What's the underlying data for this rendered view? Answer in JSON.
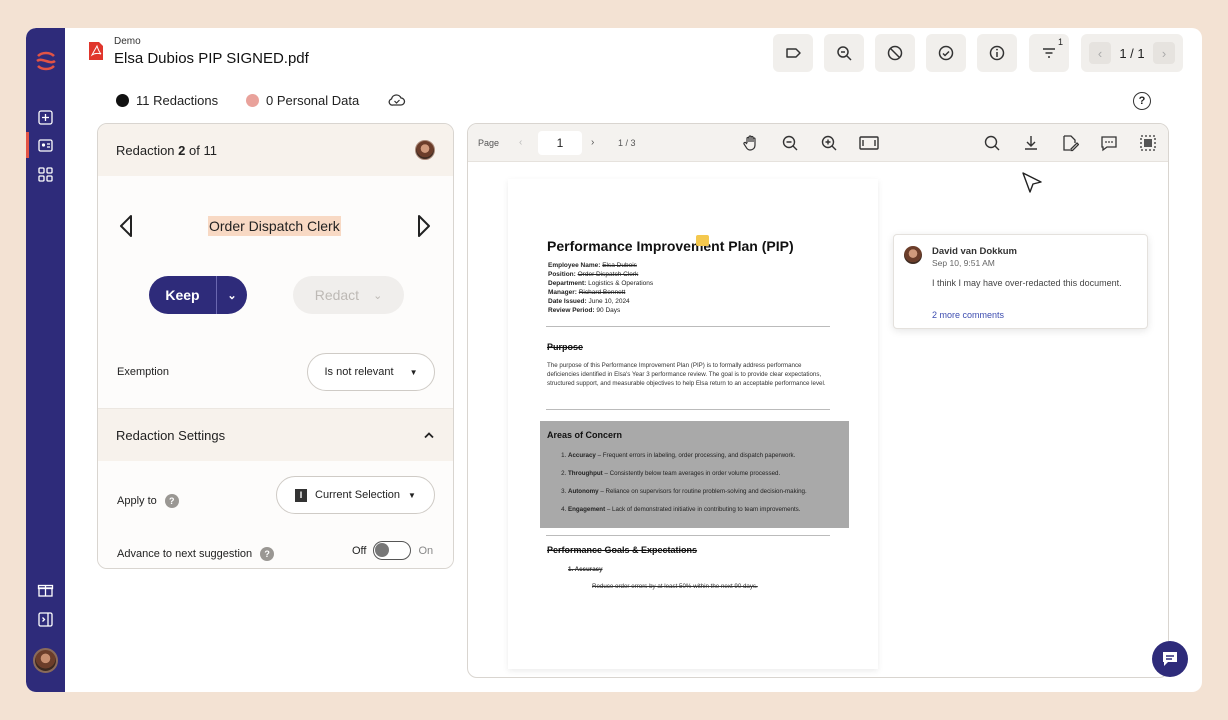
{
  "header": {
    "workspace": "Demo",
    "filename": "Elsa Dubios PIP SIGNED.pdf",
    "filter_badge": "1",
    "pager": "1 / 1"
  },
  "toolbar": {
    "icons": [
      "tag-icon",
      "zoom-search-icon",
      "block-icon",
      "check-circle-icon",
      "info-icon",
      "filter-icon"
    ]
  },
  "stats": {
    "redactions": "11 Redactions",
    "personal_data": "0 Personal Data"
  },
  "colors": {
    "brand": "#2e2b7a",
    "accent_red": "#e25345",
    "highlight": "#f8d9c4",
    "personal_dot": "#e9a29b"
  },
  "panel": {
    "redaction_prefix": "Redaction ",
    "redaction_num": "2",
    "redaction_suffix": " of 11",
    "selected_text": "Order Dispatch Clerk",
    "keep_label": "Keep",
    "redact_label": "Redact",
    "exemption_label": "Exemption",
    "exemption_value": "Is not relevant",
    "settings_title": "Redaction Settings",
    "apply_to_label": "Apply to",
    "apply_to_value": "Current Selection",
    "advance_label": "Advance to next suggestion",
    "toggle_off": "Off",
    "toggle_on": "On"
  },
  "viewer": {
    "page_label": "Page",
    "page_value": "1",
    "page_total": "1 / 3"
  },
  "document": {
    "title": "Performance Improvement Plan (PIP)",
    "fields": [
      {
        "label": "Employee Name:",
        "value": "Elsa Dubois",
        "struck": true
      },
      {
        "label": "Position:",
        "value": "Order Dispatch Clerk",
        "struck": true
      },
      {
        "label": "Department:",
        "value": "Logistics & Operations",
        "struck": false
      },
      {
        "label": "Manager:",
        "value": "Richard Bennett",
        "struck": true
      },
      {
        "label": "Date Issued:",
        "value": "June 10, 2024",
        "struck": false
      },
      {
        "label": "Review Period:",
        "value": "90 Days",
        "struck": false
      }
    ],
    "purpose_title": "Purpose",
    "purpose_text": "The purpose of this Performance Improvement Plan (PIP) is to formally address performance deficiencies identified in Elsa's Year 3 performance review. The goal is to provide clear expectations, structured support, and measurable objectives to help Elsa return to an acceptable performance level.",
    "concern_title": "Areas of Concern",
    "concerns": [
      {
        "term": "Accuracy",
        "text": " – Frequent errors in labeling, order processing, and dispatch paperwork."
      },
      {
        "term": "Throughput",
        "text": " – Consistently below team averages in order volume processed."
      },
      {
        "term": "Autonomy",
        "text": " – Reliance on supervisors for routine problem-solving and decision-making."
      },
      {
        "term": "Engagement",
        "text": " – Lack of demonstrated initiative in contributing to team improvements."
      }
    ],
    "goals_title": "Performance Goals & Expectations",
    "goal_item": "1.  Accuracy",
    "goal_sub": "Reduce order errors by at least 50% within the next 90 days."
  },
  "comment": {
    "author": "David van Dokkum",
    "time": "Sep 10, 9:51 AM",
    "body": "I think I may have over-redacted this document.",
    "more": "2 more comments"
  }
}
